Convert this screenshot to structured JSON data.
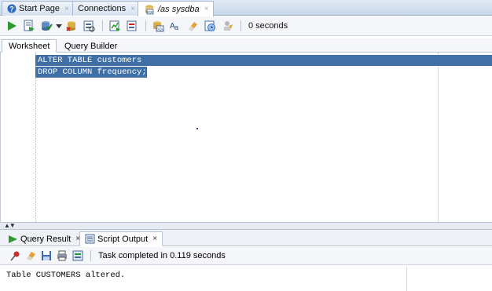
{
  "tabs": [
    {
      "label": "Start Page",
      "icon": "help-icon"
    },
    {
      "label": "Connections",
      "icon": ""
    },
    {
      "label": "/as sysdba",
      "icon": "sql-worksheet-icon"
    }
  ],
  "toolbar": {
    "status_text": "0 seconds",
    "icons": [
      "run-statement-icon",
      "run-script-icon",
      "commit-icon",
      "dropdown-arrow-icon",
      "rollback-icon",
      "explain-plan-icon",
      "autotrace-icon",
      "sql-tuning-icon",
      "sql-sql-icon",
      "format-icon",
      "eraser-icon",
      "history-icon",
      "dba-icon"
    ]
  },
  "worksheet_tabs": [
    {
      "label": "Worksheet"
    },
    {
      "label": "Query Builder"
    }
  ],
  "editor": {
    "lines": [
      "ALTER TABLE customers",
      "DROP COLUMN frequency;"
    ]
  },
  "output_tabs": [
    {
      "label": "Query Result",
      "close": "×"
    },
    {
      "label": "Script Output",
      "close": "×"
    }
  ],
  "output_toolbar": {
    "status_text": "Task completed in 0.119 seconds"
  },
  "output": {
    "text": "Table CUSTOMERS altered."
  },
  "colors": {
    "selection": "#3f6fa4",
    "run_green": "#2e9a2e",
    "pin_red": "#d22b2b"
  }
}
